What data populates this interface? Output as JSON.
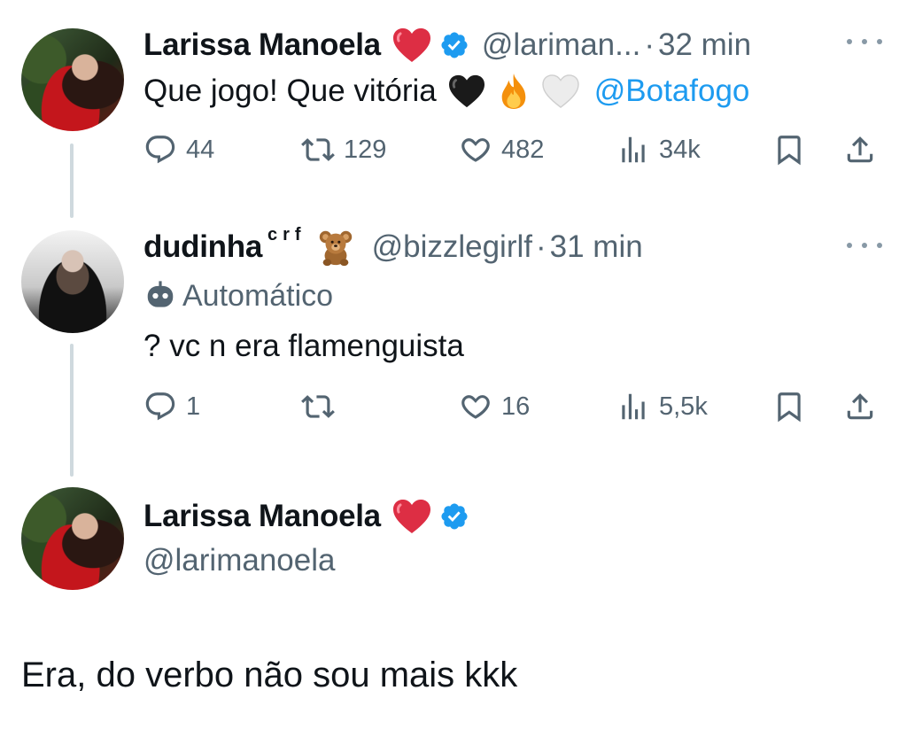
{
  "tweets": [
    {
      "author": "Larissa Manoela",
      "handle": "@lariman...",
      "separator": "·",
      "time": "32 min",
      "text": "Que jogo! Que vitória",
      "mention": "@Botafogo",
      "replies": "44",
      "retweets": "129",
      "likes": "482",
      "views": "34k"
    },
    {
      "author": "dudinha",
      "author_suffix": "crf",
      "handle": "@bizzlegirlf",
      "separator": "·",
      "time": "31 min",
      "label": "Automático",
      "text": "? vc n era flamenguista",
      "replies": "1",
      "retweets": "",
      "likes": "16",
      "views": "5,5k"
    }
  ],
  "main_tweet": {
    "author": "Larissa Manoela",
    "handle": "@larimanoela",
    "text": "Era, do verbo não sou mais kkk"
  },
  "colors": {
    "accent": "#1d9bf0",
    "muted": "#536471",
    "text": "#0f1419",
    "heart": "#e0245e"
  },
  "icons": [
    "heart-emoji",
    "verified-badge-icon",
    "black-heart-emoji",
    "fire-emoji",
    "white-heart-emoji",
    "teddy-bear-emoji",
    "bot-icon",
    "reply-icon",
    "retweet-icon",
    "like-icon",
    "views-icon",
    "bookmark-icon",
    "share-icon",
    "more-icon"
  ]
}
